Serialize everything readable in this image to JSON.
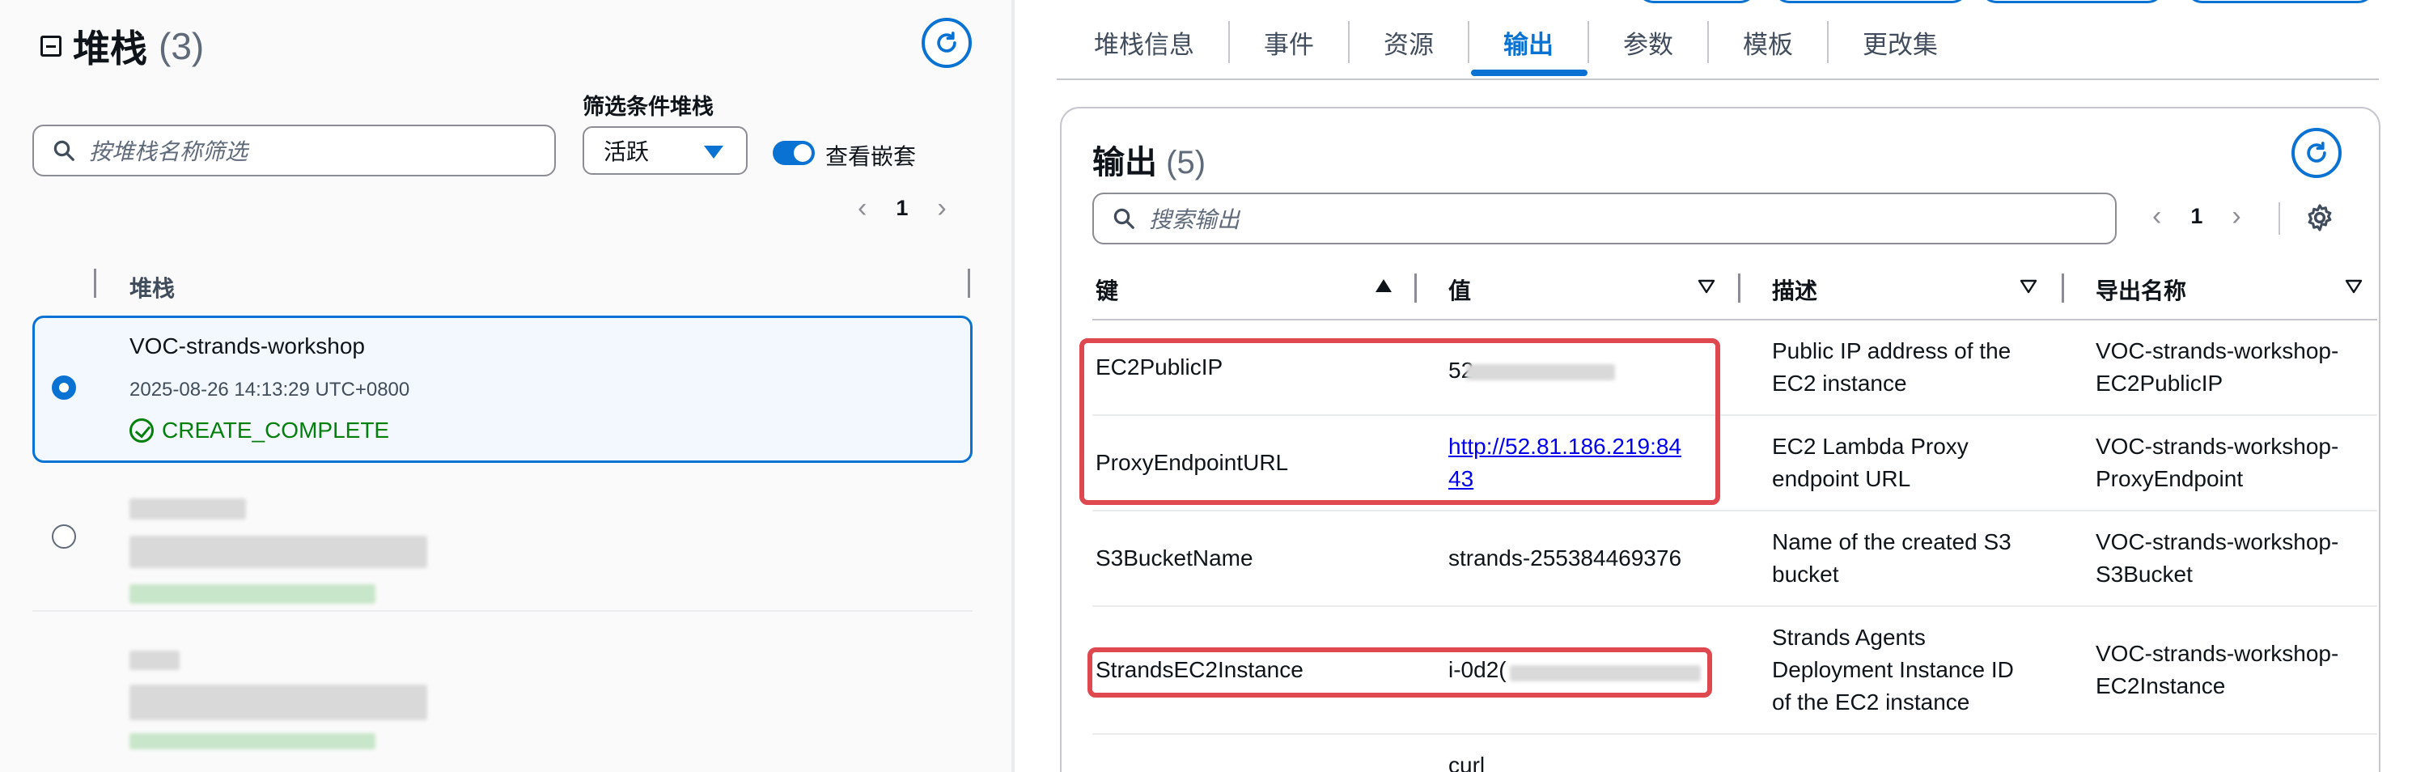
{
  "left": {
    "title": "堆栈",
    "count": "(3)",
    "search_placeholder": "按堆栈名称筛选",
    "filter_label": "筛选条件堆栈",
    "filter_value": "活跃",
    "toggle_label": "查看嵌套",
    "page": "1",
    "column_header": "堆栈",
    "stacks": [
      {
        "name": "VOC-strands-workshop",
        "date": "2025-08-26 14:13:29 UTC+0800",
        "status": "CREATE_COMPLETE",
        "selected": true
      }
    ]
  },
  "right": {
    "tabs": [
      "堆栈信息",
      "事件",
      "资源",
      "输出",
      "参数",
      "模板",
      "更改集"
    ],
    "active_tab": "输出",
    "outputs_title": "输出",
    "outputs_count": "(5)",
    "search_placeholder": "搜索输出",
    "page": "1",
    "columns": [
      "键",
      "值",
      "描述",
      "导出名称"
    ],
    "rows": [
      {
        "key": "EC2PublicIP",
        "value": "52",
        "description_lines": [
          "Public IP address of the",
          "EC2 instance"
        ],
        "export_lines": [
          "VOC-strands-workshop-",
          "EC2PublicIP"
        ]
      },
      {
        "key": "ProxyEndpointURL",
        "value_lines": [
          "http://52.81.186.219:84",
          "43"
        ],
        "description_lines": [
          "EC2 Lambda Proxy",
          "endpoint URL"
        ],
        "export_lines": [
          "VOC-strands-workshop-",
          "ProxyEndpoint"
        ]
      },
      {
        "key": "S3BucketName",
        "value": "strands-255384469376",
        "description_lines": [
          "Name of the created S3",
          "bucket"
        ],
        "export_lines": [
          "VOC-strands-workshop-",
          "S3Bucket"
        ]
      },
      {
        "key": "StrandsEC2Instance",
        "value": "i-0d2(",
        "description_lines": [
          "Strands Agents",
          "Deployment Instance ID",
          "of the EC2 instance"
        ],
        "export_lines": [
          "VOC-strands-workshop-",
          "EC2Instance"
        ]
      },
      {
        "value": "curl"
      }
    ]
  },
  "colors": {
    "accent": "#0972d3",
    "success": "#037f0c",
    "highlight": "#e0484f"
  },
  "icons": [
    "collapse-icon",
    "refresh-icon",
    "search-icon",
    "chevron-left-icon",
    "chevron-right-icon",
    "caret-down-icon",
    "check-circle-icon",
    "settings-icon",
    "sort-ascending-icon",
    "sort-descending-icon"
  ]
}
